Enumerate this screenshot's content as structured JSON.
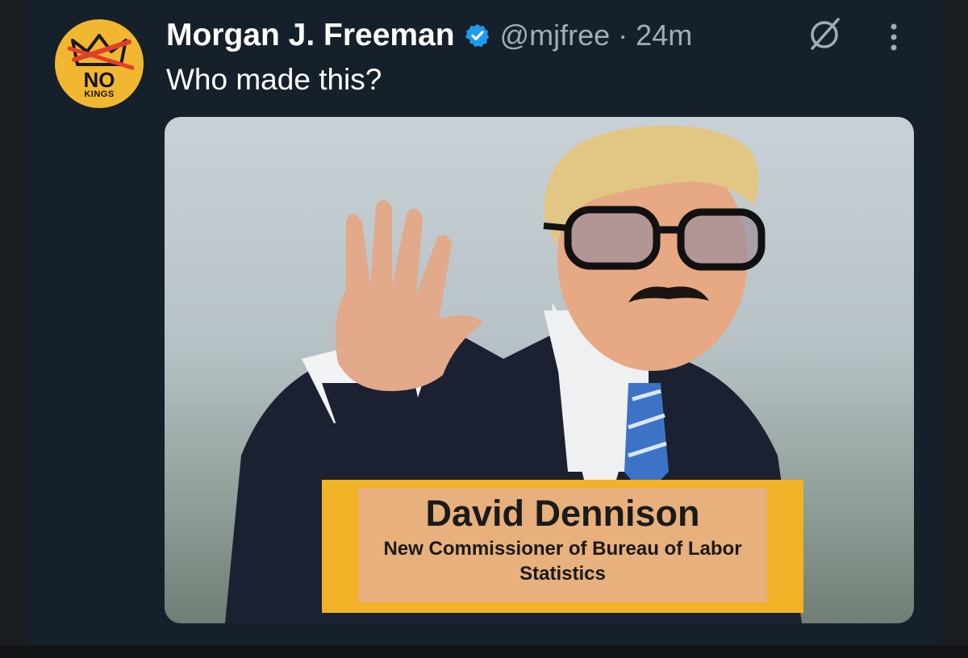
{
  "author": {
    "display_name": "Morgan J. Freeman",
    "handle": "@mjfree",
    "separator": "·",
    "timestamp": "24m",
    "verified": true,
    "avatar": {
      "text_top": "NO",
      "text_bottom": "KINGS",
      "background_color": "#f2b731"
    }
  },
  "tweet": {
    "text": "Who made this?"
  },
  "media": {
    "caption_name": "David Dennison",
    "caption_title": "New Commissioner of Bureau of Labor Statistics",
    "caption_frame_color": "#f1b227"
  },
  "icons": {
    "verified": "verified-badge-icon",
    "grok": "grok-icon",
    "more": "more-options-icon"
  },
  "colors": {
    "background": "#15202b",
    "primary_text": "#ffffff",
    "secondary_text": "#a0acb8",
    "verified_blue": "#1d9bf0"
  }
}
